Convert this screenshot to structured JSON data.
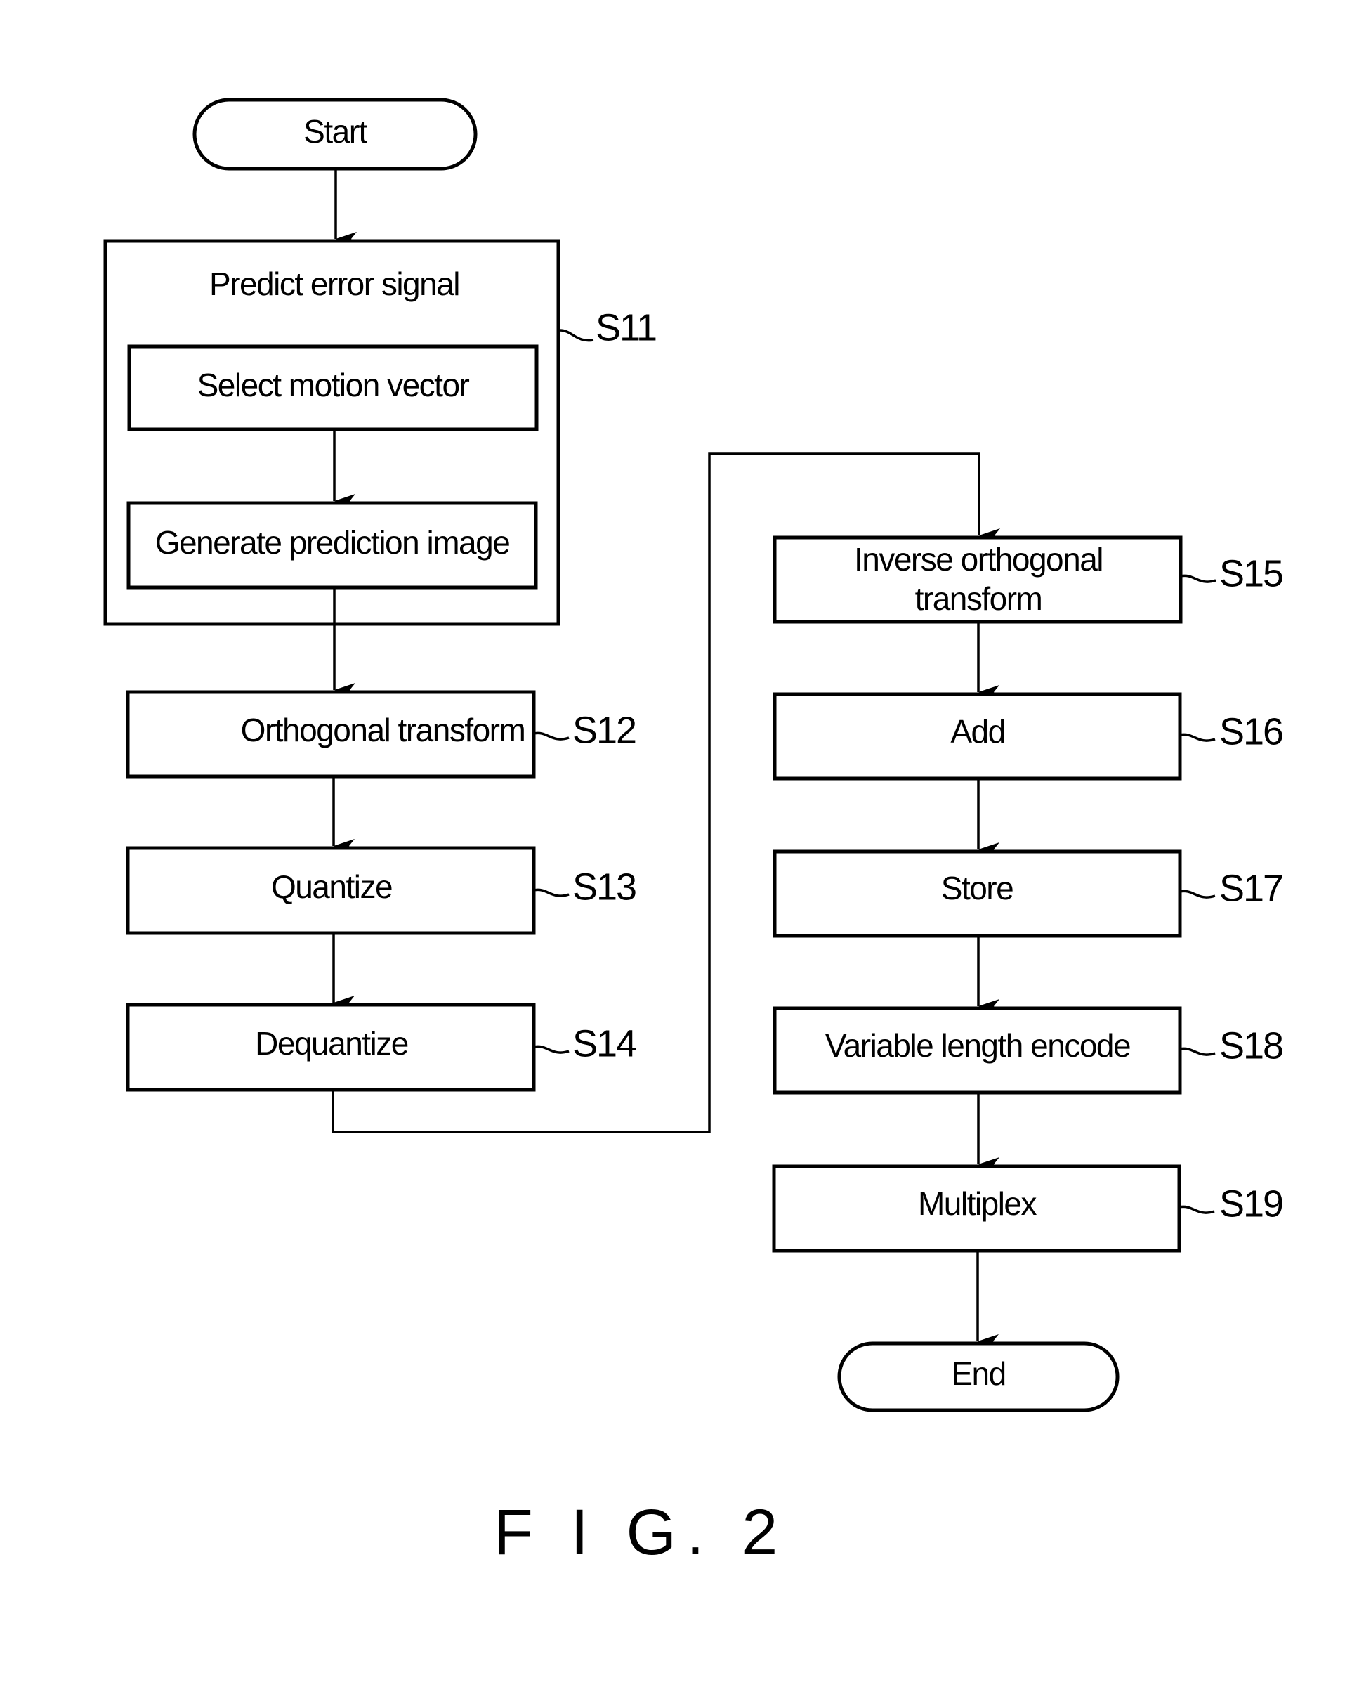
{
  "figure": {
    "caption": "F I G. 2",
    "start_label": "Start",
    "end_label": "End",
    "group": {
      "ref": "S11",
      "title": "Predict error signal",
      "substeps": [
        "Select motion vector",
        "Generate prediction image"
      ]
    },
    "steps": [
      {
        "ref": "S12",
        "label": "Orthogonal transform"
      },
      {
        "ref": "S13",
        "label": "Quantize"
      },
      {
        "ref": "S14",
        "label": "Dequantize"
      },
      {
        "ref": "S15",
        "label_line1": "Inverse orthogonal",
        "label_line2": "transform"
      },
      {
        "ref": "S16",
        "label": "Add"
      },
      {
        "ref": "S17",
        "label": "Store"
      },
      {
        "ref": "S18",
        "label": "Variable length encode"
      },
      {
        "ref": "S19",
        "label": "Multiplex"
      }
    ]
  }
}
